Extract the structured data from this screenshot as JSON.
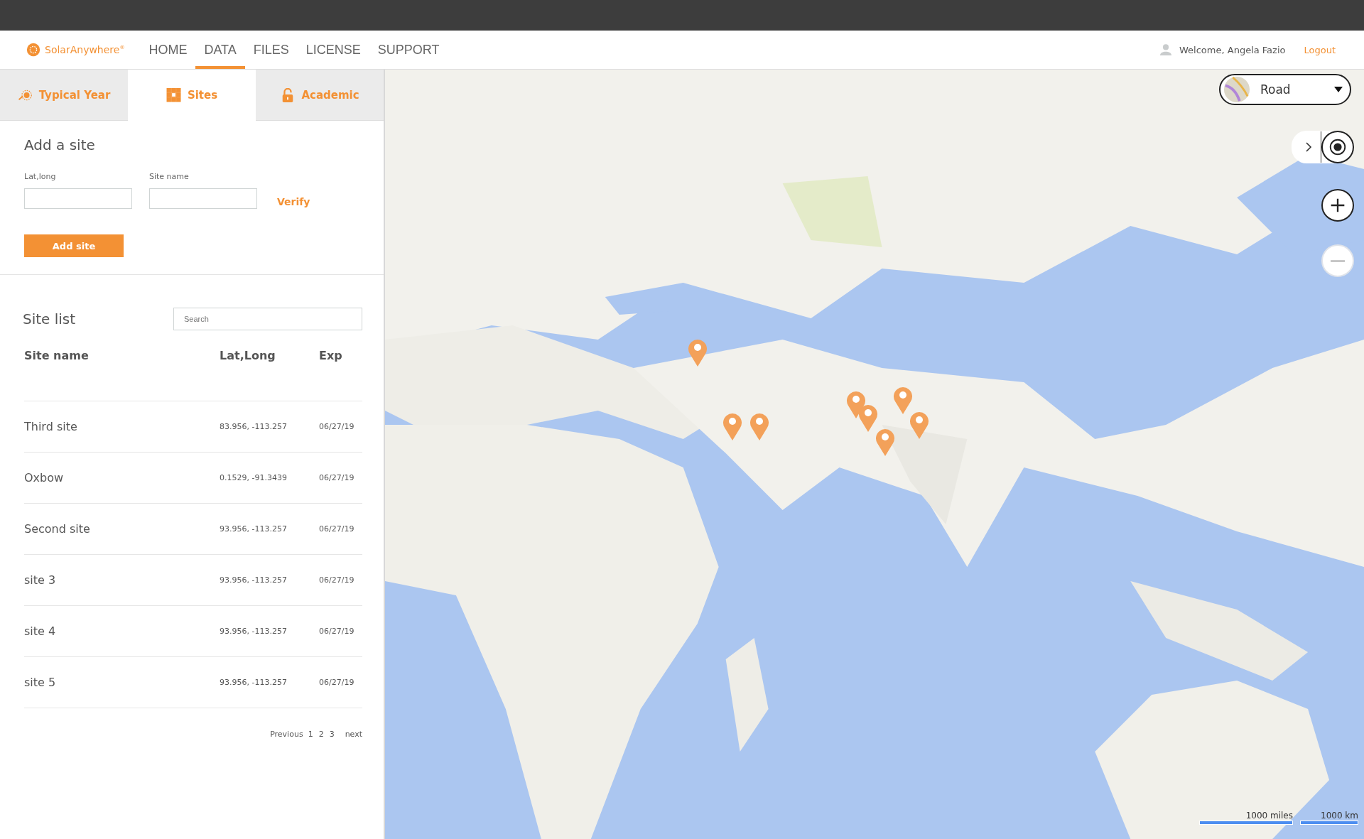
{
  "brand": {
    "name": "SolarAnywhere",
    "mark": "®"
  },
  "nav": [
    {
      "label": "HOME",
      "selected": false
    },
    {
      "label": "DATA",
      "selected": true
    },
    {
      "label": "FILES",
      "selected": false
    },
    {
      "label": "LICENSE",
      "selected": false
    },
    {
      "label": "SUPPORT",
      "selected": false
    }
  ],
  "user": {
    "welcome": "Welcome, Angela Fazio",
    "logout": "Logout"
  },
  "tabs": [
    {
      "label": "Typical Year",
      "kind": "sun",
      "selected": false
    },
    {
      "label": "Sites",
      "kind": "grid",
      "selected": true
    },
    {
      "label": "Academic",
      "kind": "lock",
      "selected": false
    }
  ],
  "add_site": {
    "title": "Add a site",
    "latlong_label": "Lat,long",
    "name_label": "Site name",
    "verify": "Verify",
    "button": "Add site"
  },
  "site_list": {
    "title": "Site list",
    "search_placeholder": "Search",
    "columns": [
      "Site name",
      "Lat,Long",
      "Exp"
    ],
    "rows": [
      {
        "name": "Third site",
        "latlong": "83.956, -113.257",
        "exp": "06/27/19"
      },
      {
        "name": "Oxbow",
        "latlong": "0.1529, -91.3439",
        "exp": "06/27/19"
      },
      {
        "name": "Second site",
        "latlong": "93.956, -113.257",
        "exp": "06/27/19"
      },
      {
        "name": "site 3",
        "latlong": "93.956, -113.257",
        "exp": "06/27/19"
      },
      {
        "name": "site 4",
        "latlong": "93.956, -113.257",
        "exp": "06/27/19"
      },
      {
        "name": "site 5",
        "latlong": "93.956, -113.257",
        "exp": "06/27/19"
      }
    ],
    "pagination": {
      "previous": "Previous",
      "pages": [
        "1",
        "2",
        "3"
      ],
      "next": "next"
    }
  },
  "map": {
    "kind": "picture",
    "style_select": "Road",
    "zoom_out_disabled": true,
    "scale": [
      "1000 miles",
      "1000 km"
    ]
  }
}
